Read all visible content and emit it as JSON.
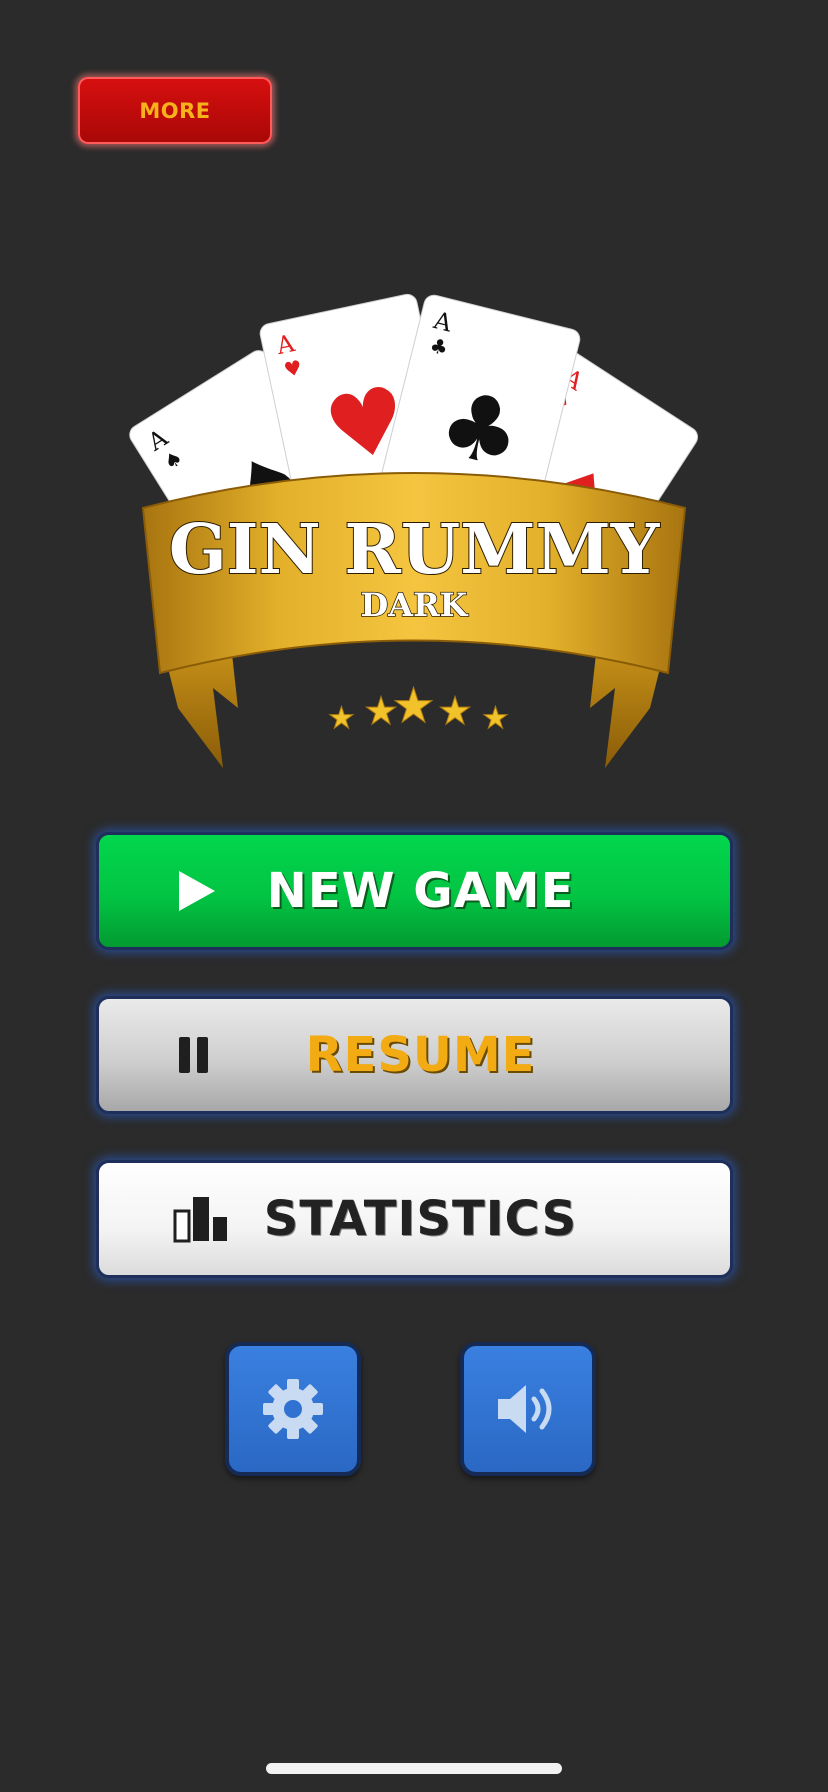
{
  "more_button": {
    "label": "MORE"
  },
  "logo": {
    "title": "GIN RUMMY",
    "subtitle": "DARK",
    "cards": [
      {
        "rank": "A",
        "suit": "spade"
      },
      {
        "rank": "A",
        "suit": "heart"
      },
      {
        "rank": "A",
        "suit": "club"
      },
      {
        "rank": "A",
        "suit": "diamond"
      }
    ],
    "stars": 5
  },
  "menu": {
    "new_game": {
      "label": "NEW GAME",
      "icon": "play-icon"
    },
    "resume": {
      "label": "RESUME",
      "icon": "pause-icon"
    },
    "statistics": {
      "label": "STATISTICS",
      "icon": "bar-chart-icon"
    }
  },
  "bottom_buttons": {
    "settings": {
      "icon": "gear-icon"
    },
    "sound": {
      "icon": "speaker-icon"
    }
  },
  "colors": {
    "background": "#2b2b2b",
    "more_red": "#c80b0b",
    "more_text": "#f7b21b",
    "new_game_green": "#02c443",
    "resume_gold": "#f2ab13",
    "ribbon_gold": "#d19a1e",
    "icon_button_blue": "#2f72d2"
  }
}
